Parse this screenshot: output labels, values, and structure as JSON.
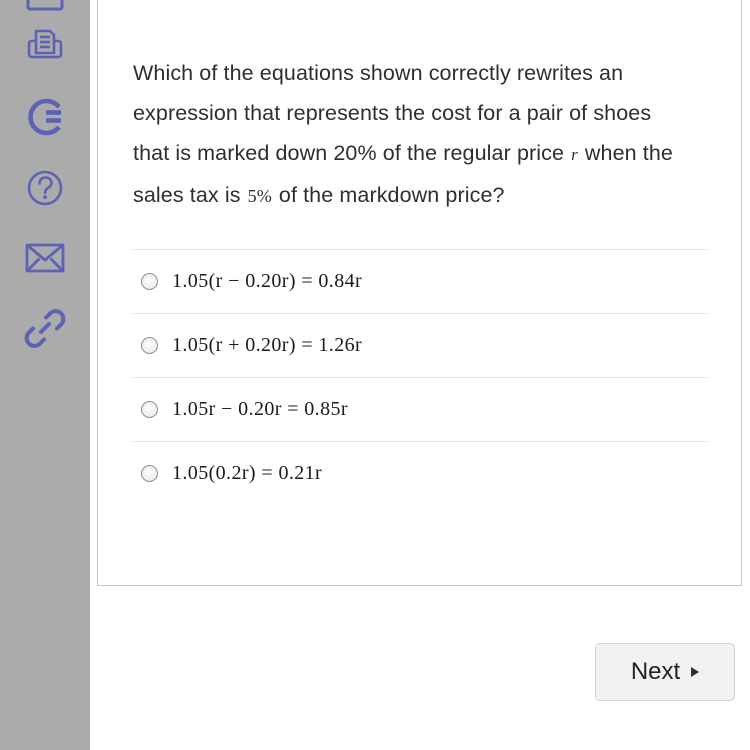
{
  "sidebar": {
    "background_color": "#ababab",
    "icon_color": "#5c63b5",
    "items": [
      {
        "name": "calculator-icon",
        "label": "Calculator"
      },
      {
        "name": "print-icon",
        "label": "Print"
      },
      {
        "name": "grammarly-g-icon",
        "label": "G"
      },
      {
        "name": "help-icon",
        "label": "Help"
      },
      {
        "name": "mail-icon",
        "label": "Mail"
      },
      {
        "name": "link-icon",
        "label": "Link"
      }
    ]
  },
  "question": {
    "part1": "Which of the equations shown correctly rewrites an expression that represents the cost for a pair of shoes that is marked down 20% of the regular price",
    "variable": "r",
    "part2": "when the sales tax is",
    "tax_rate": "5%",
    "part3": "of the markdown price?"
  },
  "options": [
    {
      "id": "option-a",
      "text": "1.05(r − 0.20r) = 0.84r",
      "selected": false
    },
    {
      "id": "option-b",
      "text": "1.05(r + 0.20r) = 1.26r",
      "selected": false
    },
    {
      "id": "option-c",
      "text": "1.05r − 0.20r = 0.85r",
      "selected": false
    },
    {
      "id": "option-d",
      "text": "1.05(0.2r) = 0.21r",
      "selected": false
    }
  ],
  "footer": {
    "next_label": "Next",
    "next_arrow_icon": "triangle-right-icon"
  }
}
